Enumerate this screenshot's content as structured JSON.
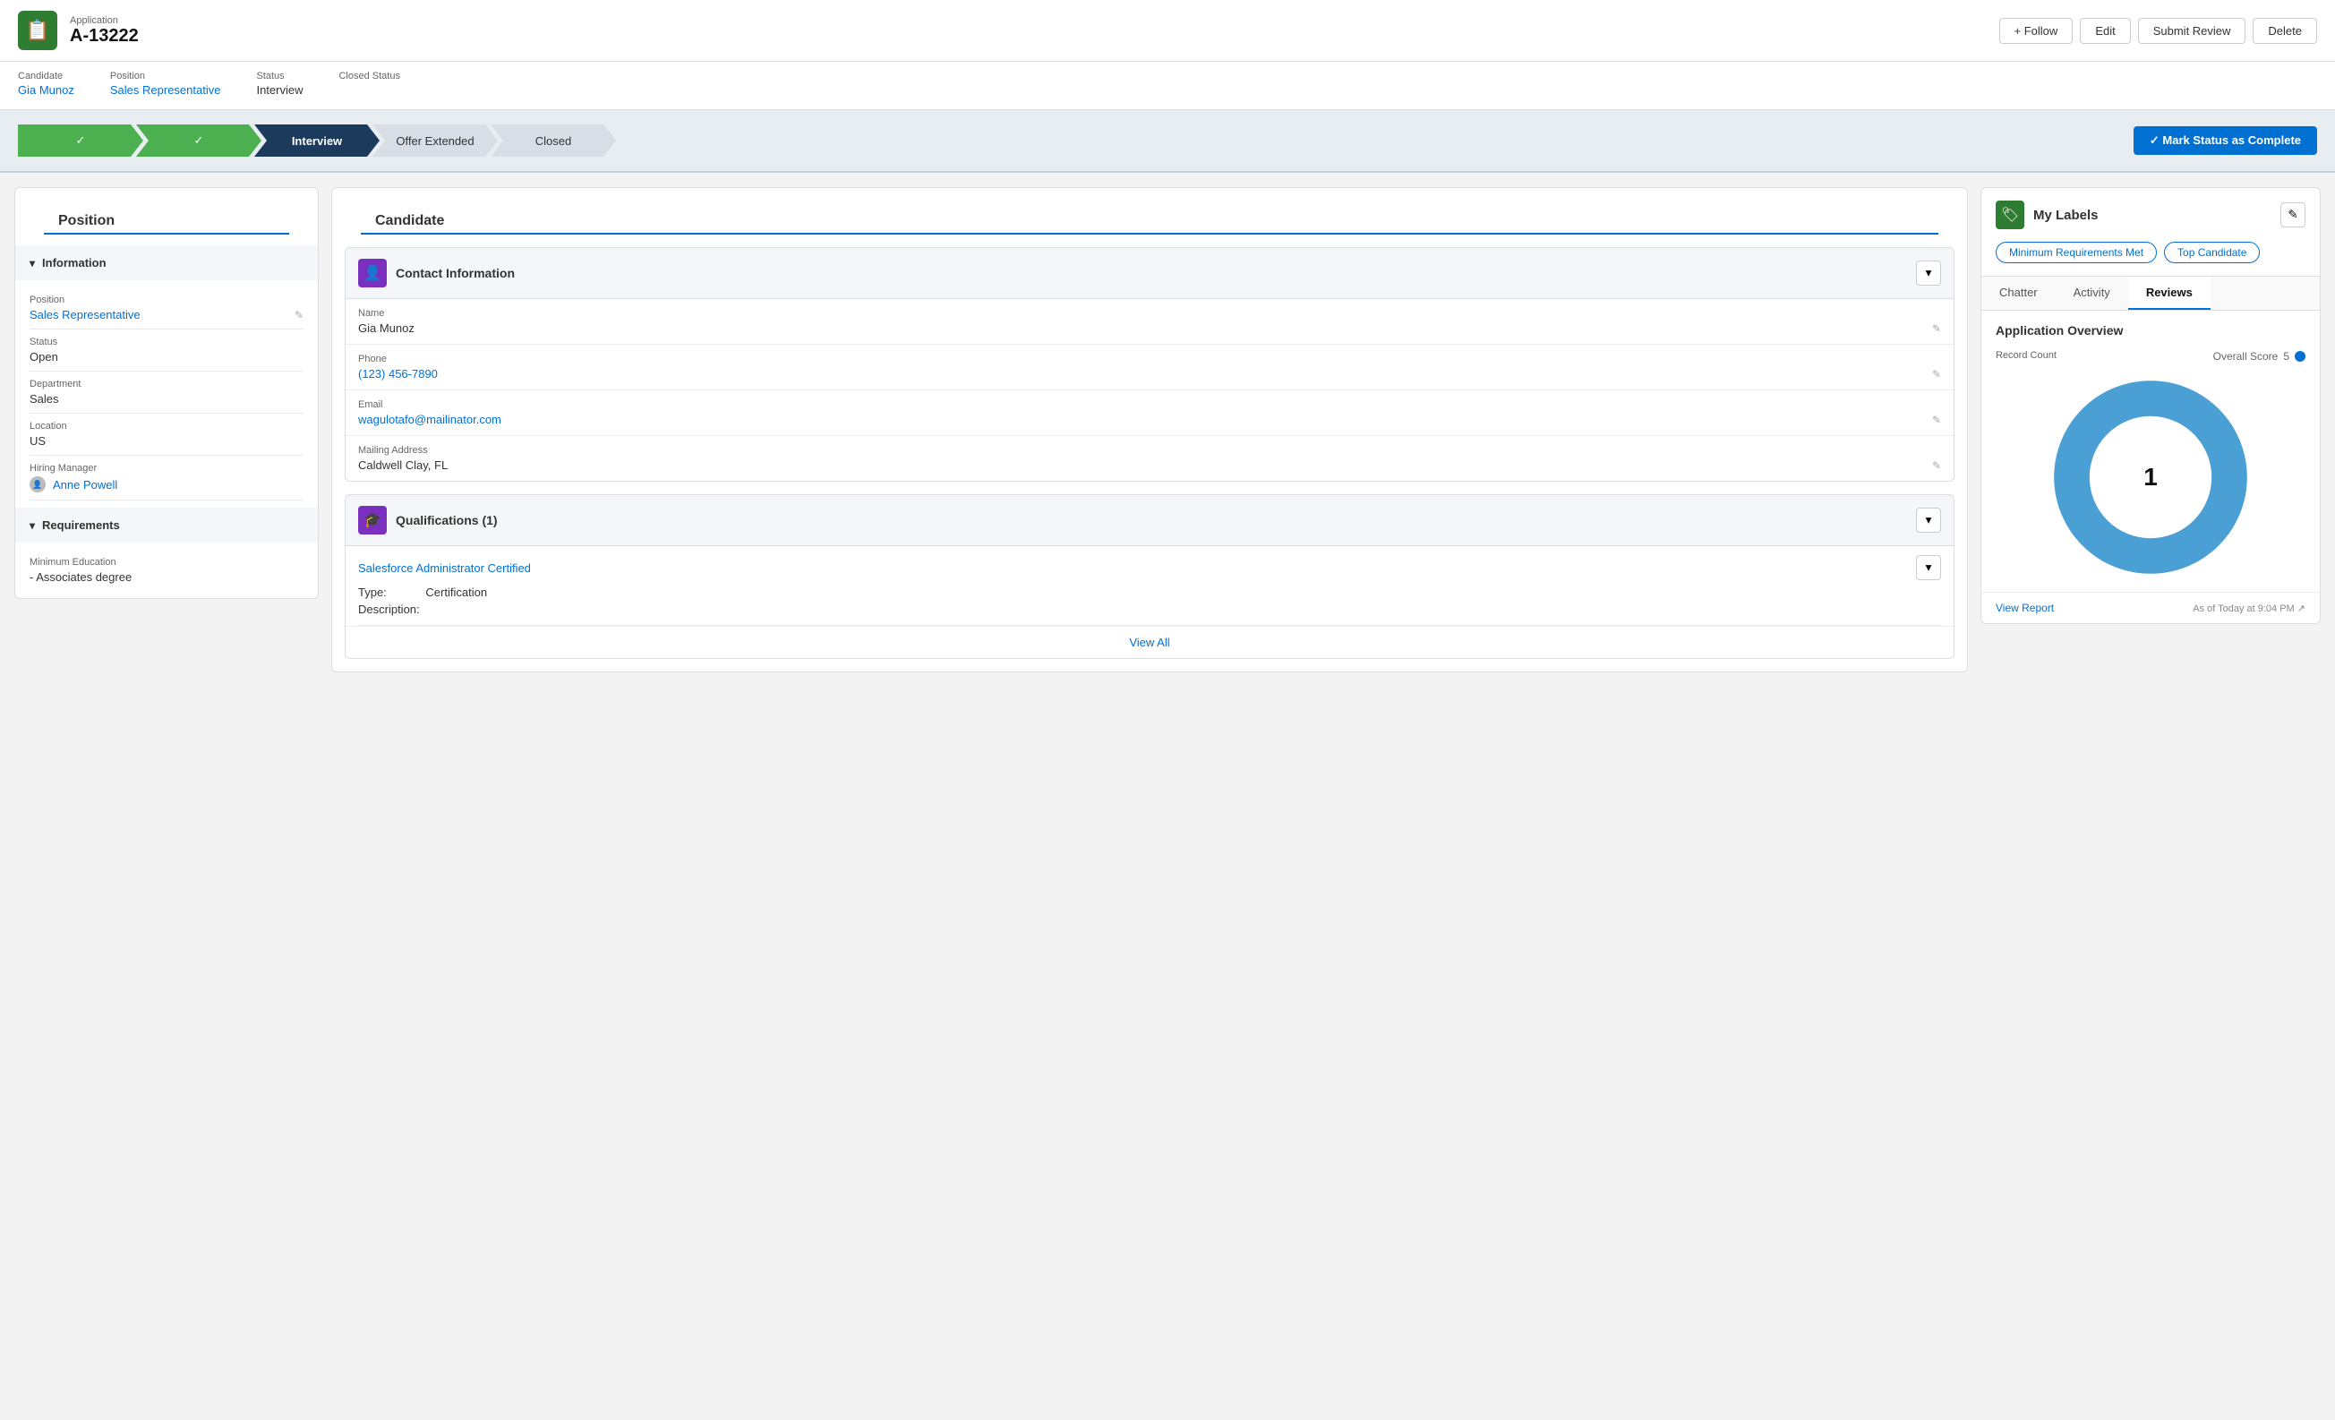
{
  "app": {
    "label": "Application",
    "id": "A-13222",
    "icon": "📋"
  },
  "header": {
    "follow_label": "+ Follow",
    "edit_label": "Edit",
    "submit_review_label": "Submit Review",
    "delete_label": "Delete"
  },
  "breadcrumbs": [
    {
      "label": "Candidate",
      "value": "Gia Munoz",
      "is_link": true
    },
    {
      "label": "Position",
      "value": "Sales Representative",
      "is_link": true
    },
    {
      "label": "Status",
      "value": "Interview",
      "is_link": false
    },
    {
      "label": "Closed Status",
      "value": "",
      "is_link": false
    }
  ],
  "stages": [
    {
      "label": "✓",
      "state": "completed"
    },
    {
      "label": "✓",
      "state": "completed"
    },
    {
      "label": "Interview",
      "state": "active"
    },
    {
      "label": "Offer Extended",
      "state": "normal"
    },
    {
      "label": "Closed",
      "state": "normal"
    }
  ],
  "mark_status_btn": "✓  Mark Status as Complete",
  "left_panel": {
    "title": "Position",
    "information_section": {
      "header": "Information",
      "fields": [
        {
          "label": "Position",
          "value": "Sales Representative",
          "is_link": true
        },
        {
          "label": "Status",
          "value": "Open",
          "is_link": false
        },
        {
          "label": "Department",
          "value": "Sales",
          "is_link": false
        },
        {
          "label": "Location",
          "value": "US",
          "is_link": false
        },
        {
          "label": "Hiring Manager",
          "value": "Anne Powell",
          "is_link": true
        }
      ]
    },
    "requirements_section": {
      "header": "Requirements",
      "fields": [
        {
          "label": "Minimum Education",
          "value": "- Associates degree"
        }
      ]
    }
  },
  "middle_panel": {
    "title": "Candidate",
    "contact_card": {
      "title": "Contact Information",
      "fields": [
        {
          "label": "Name",
          "value": "Gia Munoz",
          "is_link": false
        },
        {
          "label": "Phone",
          "value": "(123) 456-7890",
          "is_link": true
        },
        {
          "label": "Email",
          "value": "wagulotafo@mailinator.com",
          "is_link": true
        },
        {
          "label": "Mailing Address",
          "value": "Caldwell Clay, FL",
          "is_link": false
        }
      ]
    },
    "qualifications_card": {
      "title": "Qualifications (1)",
      "items": [
        {
          "name": "Salesforce Administrator Certified",
          "type": "Certification",
          "description": ""
        }
      ],
      "view_all_label": "View All"
    }
  },
  "right_panel": {
    "labels_title": "My Labels",
    "labels": [
      "Minimum Requirements Met",
      "Top Candidate"
    ],
    "tabs": [
      "Chatter",
      "Activity",
      "Reviews"
    ],
    "active_tab": "Reviews",
    "overview": {
      "title": "Application Overview",
      "record_count_label": "Record Count",
      "overall_score_label": "Overall Score",
      "score_value": "5",
      "center_value": "1"
    },
    "view_report_label": "View Report",
    "timestamp": "As of Today at 9:04 PM"
  }
}
